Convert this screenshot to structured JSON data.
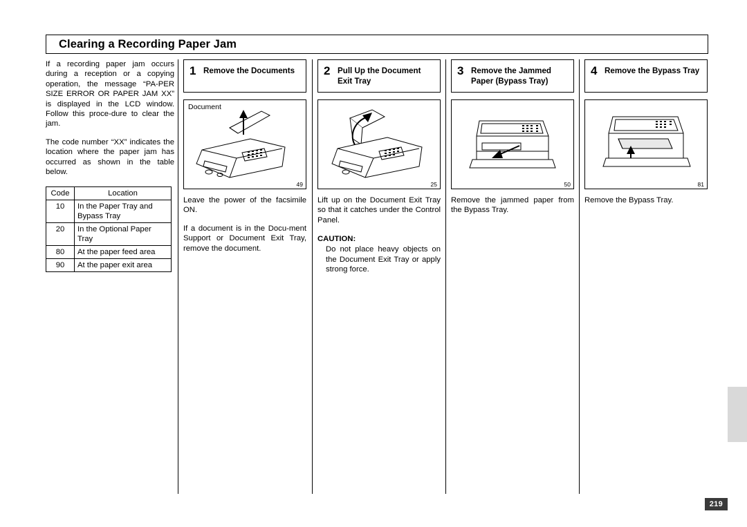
{
  "page": {
    "title": "Clearing a Recording Paper Jam",
    "page_number": "219"
  },
  "intro": {
    "paragraph1": "If a recording paper jam occurs during a reception or a copying operation, the message “PA-PER SIZE ERROR OR PAPER JAM  XX” is displayed in the LCD window. Follow this proce-dure to clear the jam.",
    "paragraph2": "The code number “XX” indicates the location where the paper jam has occurred as shown in the table below."
  },
  "code_table": {
    "headers": [
      "Code",
      "Location"
    ],
    "rows": [
      [
        "10",
        "In the Paper Tray and Bypass Tray"
      ],
      [
        "20",
        "In the Optional Paper Tray"
      ],
      [
        "80",
        "At the paper feed area"
      ],
      [
        "90",
        "At the paper exit area"
      ]
    ]
  },
  "steps": [
    {
      "number": "1",
      "title": "Remove the Documents",
      "illustration_label": "Document",
      "illustration_number": "49",
      "body": "Leave the power of the facsimile ON.",
      "body2": "If a document is in the Docu-ment Support or Document Exit Tray, remove the document."
    },
    {
      "number": "2",
      "title": "Pull Up the Document Exit Tray",
      "illustration_number": "25",
      "body": "Lift up on the Document Exit Tray so that it catches under the Control Panel.",
      "caution_label": "CAUTION:",
      "caution_body": "Do not place heavy objects on the Document Exit Tray or apply strong force."
    },
    {
      "number": "3",
      "title": "Remove the Jammed Paper (Bypass Tray)",
      "illustration_number": "50",
      "body": "Remove the jammed paper from the Bypass Tray."
    },
    {
      "number": "4",
      "title": "Remove the Bypass Tray",
      "illustration_number": "81",
      "body": "Remove the Bypass Tray."
    }
  ]
}
